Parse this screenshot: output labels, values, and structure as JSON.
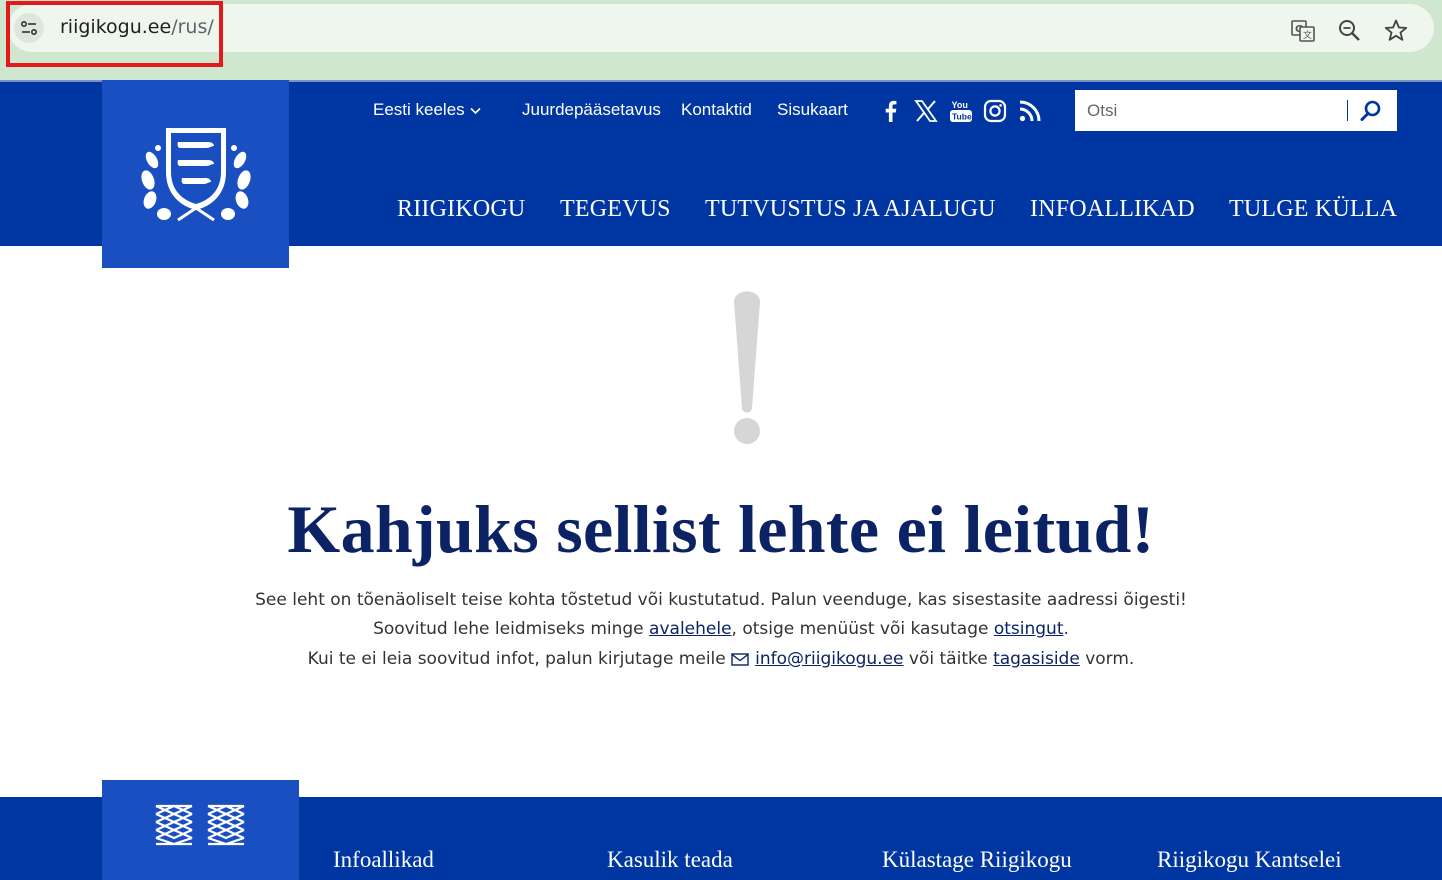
{
  "browser": {
    "url_domain": "riigikogu.ee",
    "url_path": "/rus/",
    "icons": [
      "site-info-icon",
      "translate-icon",
      "zoom-icon",
      "bookmark-star-icon"
    ]
  },
  "header": {
    "language_label": "Eesti keeles",
    "top_links": [
      "Juurdepääsetavus",
      "Kontaktid",
      "Sisukaart"
    ],
    "social_icons": [
      "facebook-icon",
      "x-twitter-icon",
      "youtube-icon",
      "instagram-icon",
      "rss-icon"
    ],
    "search_placeholder": "Otsi",
    "nav": [
      "RIIGIKOGU",
      "TEGEVUS",
      "TUTVUSTUS JA AJALUGU",
      "INFOALLIKAD",
      "TULGE KÜLLA"
    ]
  },
  "error": {
    "title": "Kahjuks sellist lehte ei leitud!",
    "line1": "See leht on tõenäoliselt teise kohta tõstetud või kustutatud. Palun veenduge, kas sisestasite aadressi õigesti!",
    "line2_pre": "Soovitud lehe leidmiseks minge ",
    "line2_link1": "avalehele",
    "line2_mid": ", otsige menüüst või kasutage ",
    "line2_link2": "otsingut",
    "line2_post": ".",
    "line3_pre": "Kui te ei leia soovitud infot, palun kirjutage meile ",
    "line3_email": "info@riigikogu.ee",
    "line3_mid": " või täitke ",
    "line3_link": "tagasiside",
    "line3_post": " vorm."
  },
  "footer": {
    "headings": [
      "Infoallikad",
      "Kasulik teada",
      "Külastage Riigikogu",
      "Riigikogu Kantselei"
    ]
  },
  "colors": {
    "header_blue": "#0036a1",
    "logo_blue": "#1a4fc2",
    "title_navy": "#0b2265",
    "highlight_red": "#e41a1a",
    "chrome_green": "#cfe6cf"
  }
}
